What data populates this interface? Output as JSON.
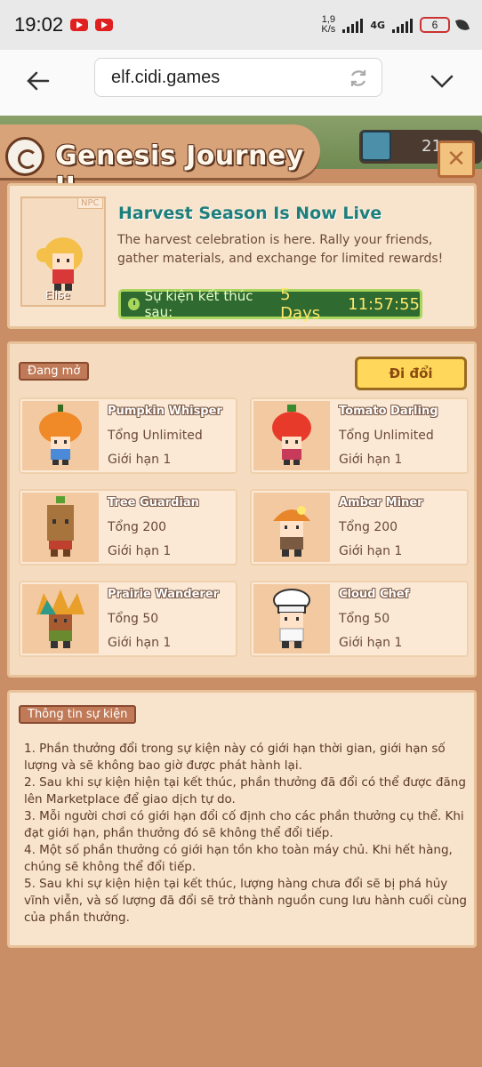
{
  "status_bar": {
    "time": "19:02",
    "speed_value": "1,9",
    "speed_unit": "K/s",
    "network": "4G",
    "battery": "6"
  },
  "browser": {
    "url": "elf.cidi.games"
  },
  "header": {
    "title": "Genesis Journey II",
    "currency_value": "21",
    "close_label": "✕"
  },
  "event": {
    "npc_tag": "NPC",
    "npc_name": "Elise",
    "title": "Harvest Season Is Now Live",
    "description": "The harvest celebration is here. Rally your friends, gather materials, and exchange for limited rewards!",
    "timer_label": "Sự kiện kết thúc sau:",
    "timer_days": "5 Days",
    "timer_clock": "11:57:55"
  },
  "shop": {
    "status_tag": "Đang mở",
    "exchange_button": "Đi đổi",
    "items": [
      {
        "name": "Pumpkin Whisper",
        "total": "Tổng Unlimited",
        "limit": "Giới hạn 1",
        "icon": "pumpkin-character-icon"
      },
      {
        "name": "Tomato Darling",
        "total": "Tổng Unlimited",
        "limit": "Giới hạn 1",
        "icon": "tomato-character-icon"
      },
      {
        "name": "Tree Guardian",
        "total": "Tổng 200",
        "limit": "Giới hạn 1",
        "icon": "tree-character-icon"
      },
      {
        "name": "Amber Miner",
        "total": "Tổng 200",
        "limit": "Giới hạn 1",
        "icon": "miner-character-icon"
      },
      {
        "name": "Prairie Wanderer",
        "total": "Tổng 50",
        "limit": "Giới hạn 1",
        "icon": "feather-character-icon"
      },
      {
        "name": "Cloud Chef",
        "total": "Tổng 50",
        "limit": "Giới hạn 1",
        "icon": "chef-character-icon"
      }
    ]
  },
  "info": {
    "tag": "Thông tin sự kiện",
    "lines": [
      "1. Phần thưởng đổi trong sự kiện này có giới hạn thời gian, giới hạn số lượng và sẽ không bao giờ được phát hành lại.",
      "2. Sau khi sự kiện hiện tại kết thúc, phần thưởng đã đổi có thể được đăng lên Marketplace để giao dịch tự do.",
      "3. Mỗi người chơi có giới hạn đổi cố định cho các phần thưởng cụ thể. Khi đạt giới hạn, phần thưởng đó sẽ không thể đổi tiếp.",
      "4. Một số phần thưởng có giới hạn tồn kho toàn máy chủ. Khi hết hàng, chúng sẽ không thể đổi tiếp.",
      "5. Sau khi sự kiện hiện tại kết thúc, lượng hàng chưa đổi sẽ bị phá hủy vĩnh viễn, và số lượng đã đổi sẽ trở thành nguồn cung lưu hành cuối cùng của phần thưởng."
    ]
  },
  "colors": {
    "accent_green": "#2f6a30",
    "title_teal": "#1d7f7c",
    "button_yellow": "#ffd75a"
  }
}
